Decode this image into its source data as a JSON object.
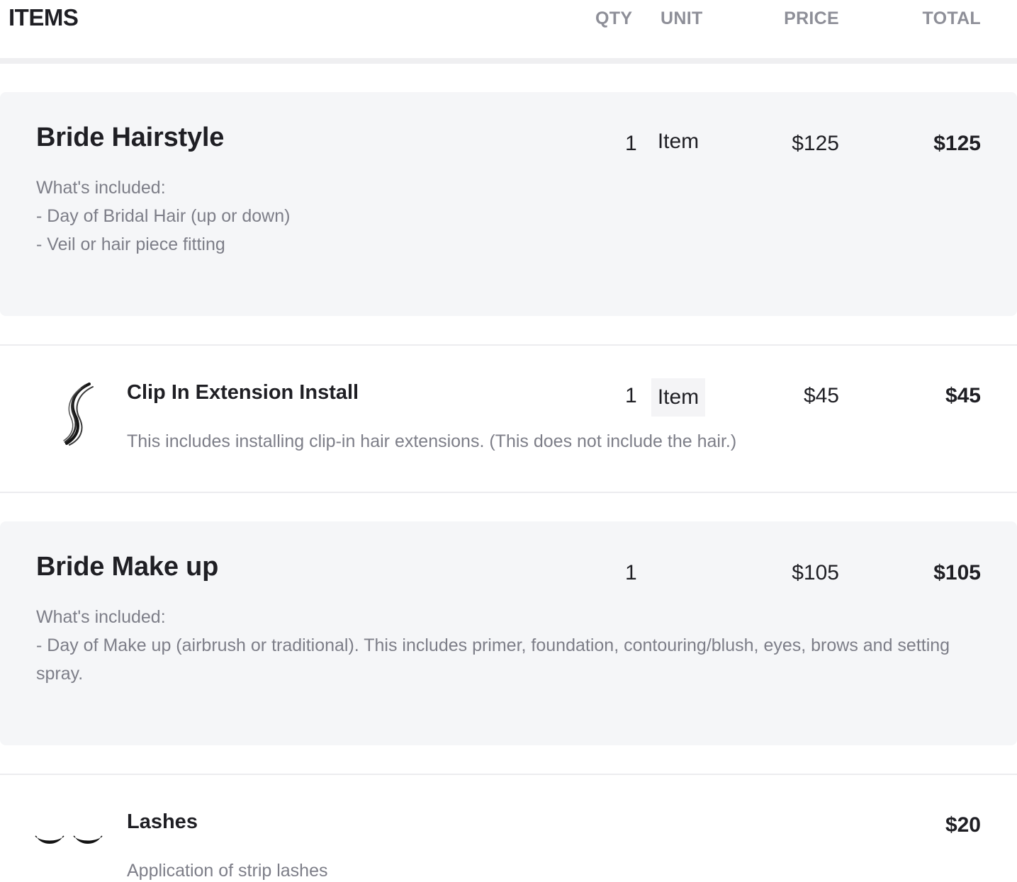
{
  "header": {
    "title": "ITEMS",
    "columns": {
      "qty": "QTY",
      "unit": "UNIT",
      "price": "PRICE",
      "total": "TOTAL"
    }
  },
  "items": [
    {
      "title": "Bride Hairstyle",
      "qty": "1",
      "unit": "Item",
      "price": "$125",
      "total": "$125",
      "description": [
        "What's included:",
        "- Day of Bridal Hair (up or down)",
        "- Veil or hair piece fitting"
      ]
    },
    {
      "title": "Clip In Extension Install",
      "qty": "1",
      "unit": "Item",
      "price": "$45",
      "total": "$45",
      "icon": "hair-wave-icon",
      "description": [
        "This includes installing clip-in hair extensions. (This does not include the hair.)"
      ]
    },
    {
      "title": "Bride Make up",
      "qty": "1",
      "price": "$105",
      "total": "$105",
      "description": [
        "What's included:",
        "- Day of Make up (airbrush or traditional). This includes primer, foundation, contouring/blush, eyes, brows and setting spray."
      ]
    },
    {
      "title": "Lashes",
      "total": "$20",
      "icon": "lashes-icon",
      "description": [
        "Application of strip lashes"
      ]
    }
  ]
}
